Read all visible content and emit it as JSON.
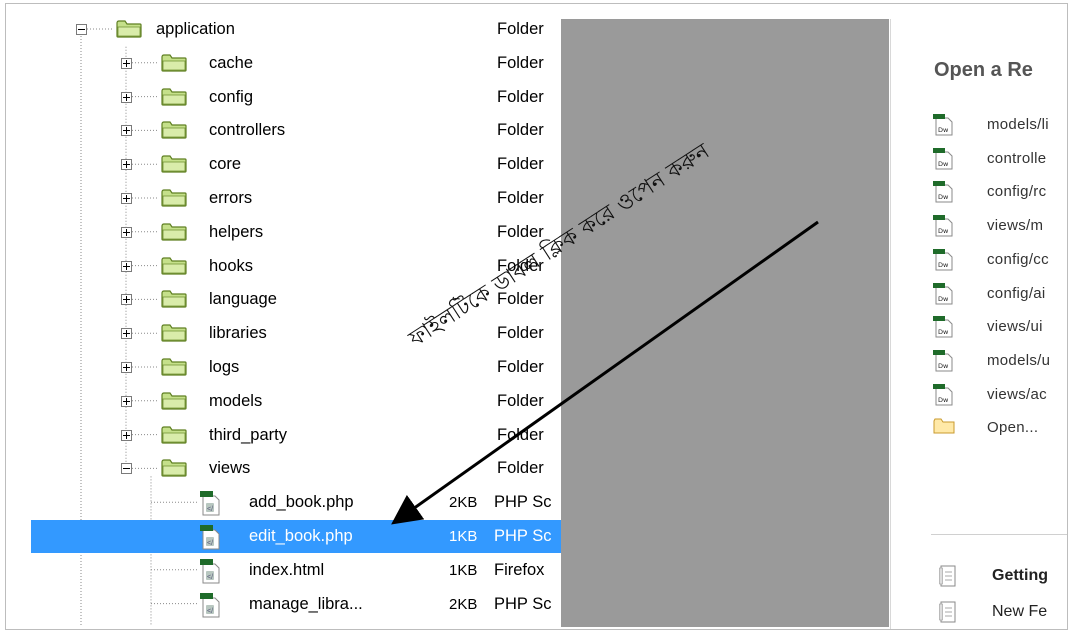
{
  "files_panel": {
    "rows": [
      {
        "name": "application",
        "size": "",
        "type": "Folder",
        "kind": "folder",
        "toggle": "minus",
        "depth": 0
      },
      {
        "name": "cache",
        "size": "",
        "type": "Folder",
        "kind": "folder",
        "toggle": "plus",
        "depth": 1
      },
      {
        "name": "config",
        "size": "",
        "type": "Folder",
        "kind": "folder",
        "toggle": "plus",
        "depth": 1
      },
      {
        "name": "controllers",
        "size": "",
        "type": "Folder",
        "kind": "folder",
        "toggle": "plus",
        "depth": 1
      },
      {
        "name": "core",
        "size": "",
        "type": "Folder",
        "kind": "folder",
        "toggle": "plus",
        "depth": 1
      },
      {
        "name": "errors",
        "size": "",
        "type": "Folder",
        "kind": "folder",
        "toggle": "plus",
        "depth": 1
      },
      {
        "name": "helpers",
        "size": "",
        "type": "Folder",
        "kind": "folder",
        "toggle": "plus",
        "depth": 1
      },
      {
        "name": "hooks",
        "size": "",
        "type": "Folder",
        "kind": "folder",
        "toggle": "plus",
        "depth": 1
      },
      {
        "name": "language",
        "size": "",
        "type": "Folder",
        "kind": "folder",
        "toggle": "plus",
        "depth": 1
      },
      {
        "name": "libraries",
        "size": "",
        "type": "Folder",
        "kind": "folder",
        "toggle": "plus",
        "depth": 1
      },
      {
        "name": "logs",
        "size": "",
        "type": "Folder",
        "kind": "folder",
        "toggle": "plus",
        "depth": 1
      },
      {
        "name": "models",
        "size": "",
        "type": "Folder",
        "kind": "folder",
        "toggle": "plus",
        "depth": 1
      },
      {
        "name": "third_party",
        "size": "",
        "type": "Folder",
        "kind": "folder",
        "toggle": "plus",
        "depth": 1
      },
      {
        "name": "views",
        "size": "",
        "type": "Folder",
        "kind": "folder",
        "toggle": "minus",
        "depth": 1
      },
      {
        "name": "add_book.php",
        "size": "2KB",
        "type": "PHP Sc",
        "kind": "file",
        "depth": 2
      },
      {
        "name": "edit_book.php",
        "size": "1KB",
        "type": "PHP Sc",
        "kind": "file",
        "depth": 2,
        "selected": true
      },
      {
        "name": "index.html",
        "size": "1KB",
        "type": "Firefox",
        "kind": "file",
        "depth": 2
      },
      {
        "name": "manage_libra...",
        "size": "2KB",
        "type": "PHP Sc",
        "kind": "file",
        "depth": 2
      }
    ]
  },
  "start_panel": {
    "title": "Open a Re",
    "recent_items": [
      {
        "label": "models/li",
        "icon": "dw-file-icon"
      },
      {
        "label": "controlle",
        "icon": "dw-file-icon"
      },
      {
        "label": "config/rc",
        "icon": "dw-file-icon"
      },
      {
        "label": "views/m",
        "icon": "dw-file-icon"
      },
      {
        "label": "config/cc",
        "icon": "dw-file-icon"
      },
      {
        "label": "config/ai",
        "icon": "dw-file-icon"
      },
      {
        "label": "views/ui",
        "icon": "dw-file-icon"
      },
      {
        "label": "models/u",
        "icon": "dw-file-icon"
      },
      {
        "label": "views/ac",
        "icon": "dw-file-icon"
      }
    ],
    "open_label": "Open...",
    "bottom_items": [
      {
        "label": "Getting",
        "bold": true
      },
      {
        "label": "New Fe",
        "bold": false
      }
    ]
  },
  "annotation": {
    "text": "ফাইলটিকে ডাবল ক্লিক করে ওপেন করুন",
    "color": "#111111"
  },
  "colors": {
    "selection": "#3399ff",
    "grey_area": "#9a9a9a",
    "folder_green": "#b6d77a"
  }
}
